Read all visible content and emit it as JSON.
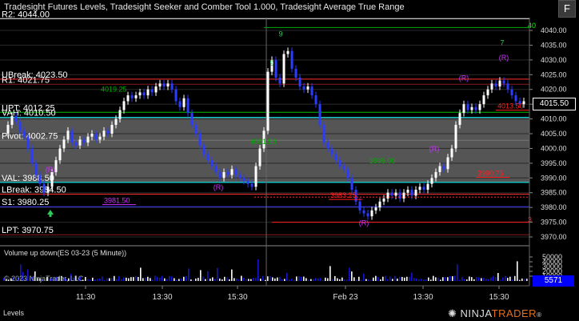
{
  "header": {
    "title": "Tradesight Futures Levels, Tradesight Seeker and Comber Tool 1.000, Tradesight Average True Range",
    "f_button": "F"
  },
  "levels": [
    {
      "label": "R2: 4044.00",
      "price": 4044.0,
      "color": "#ffffff"
    },
    {
      "label": "UBreak: 4023.50",
      "price": 4023.5,
      "color": "#ff3030"
    },
    {
      "label": "R1: 4021.75",
      "price": 4021.75,
      "color": "#8b1a1a"
    },
    {
      "label": "UPT: 4012.25",
      "price": 4012.25,
      "color": "#00c000"
    },
    {
      "label": "VAH: 4010.50",
      "price": 4010.5,
      "color": "#00ffff"
    },
    {
      "label": "Pivot: 4002.75",
      "price": 4002.75,
      "color": "#777777"
    },
    {
      "label": "VAL: 3988.50",
      "price": 3988.5,
      "color": "#00ffff"
    },
    {
      "label": "LBreak: 3984.50",
      "price": 3984.5,
      "color": "#ff3030"
    },
    {
      "label": "S1: 3980.25",
      "price": 3980.25,
      "color": "#3a3aff"
    },
    {
      "label": "LPT: 3970.75",
      "price": 3970.75,
      "color": "#8b1a1a"
    }
  ],
  "annotations": [
    {
      "text": "3981.50",
      "color": "#cc33ff"
    },
    {
      "text": "3983.25",
      "color": "#ff2020"
    },
    {
      "text": "3990.75",
      "color": "#ff2020"
    },
    {
      "text": "4013.50",
      "color": "#ff2020"
    },
    {
      "text": "4019.25",
      "color": "#00aa00"
    },
    {
      "text": "4001.50",
      "color": "#00aa00"
    },
    {
      "text": "3995.00",
      "color": "#00aa00"
    },
    {
      "text": "40",
      "color": "#00ff00"
    },
    {
      "text": "3",
      "color": "#ff2020"
    }
  ],
  "marks": {
    "setup_r": "(R)",
    "nines": "9",
    "sevens": "7"
  },
  "price_axis": {
    "ticks": [
      "4040.00",
      "4035.00",
      "4030.00",
      "4025.00",
      "4020.00",
      "4015.00",
      "4010.00",
      "4005.00",
      "4000.00",
      "3995.00",
      "3990.00",
      "3985.00",
      "3980.00",
      "3975.00",
      "3970.00"
    ],
    "current_price": "4015.50"
  },
  "time_axis": {
    "ticks": [
      "11:30",
      "13:30",
      "15:30",
      "Feb 23",
      "13:30",
      "15:30"
    ]
  },
  "volume_panel": {
    "title": "Volume up down(ES 03-23 (5 Minute))",
    "ticks": [
      "50000",
      "40000",
      "30000",
      "20000",
      "10000"
    ],
    "current": "5571",
    "copyright": "© 2023 NinjaTrader, LLC"
  },
  "footer": {
    "tab_label": "Levels",
    "logo_prefix": "NINJA",
    "logo_suffix": "TRADER",
    "logo_reg": "®"
  },
  "colors": {
    "up_candle": "#ffffff",
    "down_candle": "#2a3cff",
    "value_area": "#555555",
    "volume_bar": "#1515d0"
  }
}
